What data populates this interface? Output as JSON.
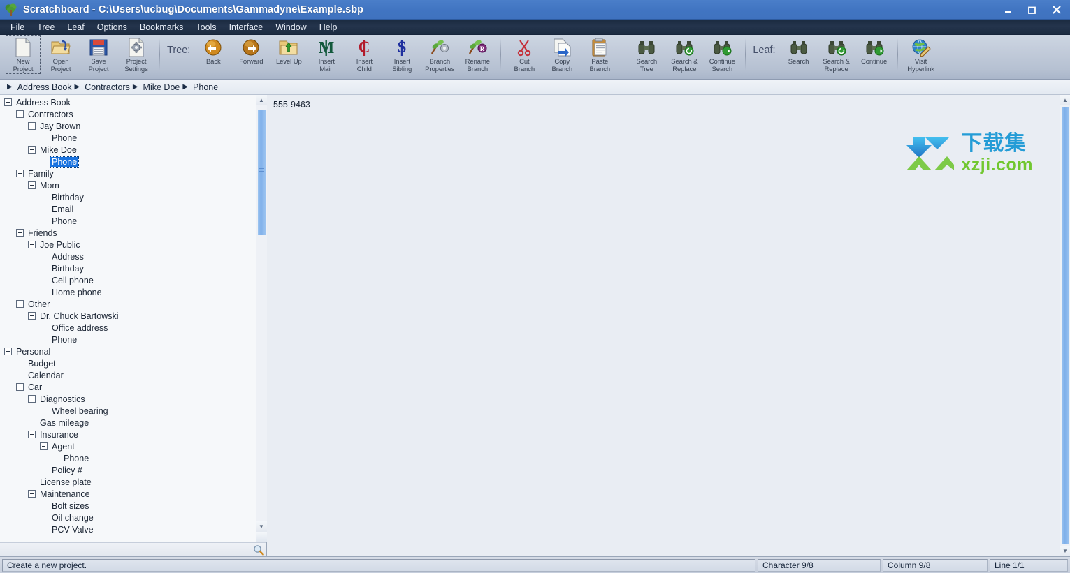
{
  "window": {
    "title": "Scratchboard - C:\\Users\\ucbug\\Documents\\Gammadyne\\Example.sbp",
    "app_icon": "tree-icon",
    "controls": {
      "minimize": "minimize-icon",
      "maximize": "maximize-icon",
      "close": "close-icon"
    }
  },
  "menubar": {
    "items": [
      {
        "label": "File",
        "accel": "F"
      },
      {
        "label": "Tree",
        "accel": "r"
      },
      {
        "label": "Leaf",
        "accel": "L"
      },
      {
        "label": "Options",
        "accel": "O"
      },
      {
        "label": "Bookmarks",
        "accel": "B"
      },
      {
        "label": "Tools",
        "accel": "T"
      },
      {
        "label": "Interface",
        "accel": "I"
      },
      {
        "label": "Window",
        "accel": "W"
      },
      {
        "label": "Help",
        "accel": "H"
      }
    ]
  },
  "toolbar": {
    "groups": [
      {
        "label": null,
        "buttons": [
          {
            "label": "New\nProject",
            "icon": "new-document-icon",
            "focused": true
          },
          {
            "label": "Open\nProject",
            "icon": "open-folder-icon",
            "focused": false
          },
          {
            "label": "Save\nProject",
            "icon": "floppy-disk-icon",
            "focused": false
          },
          {
            "label": "Project\nSettings",
            "icon": "document-gear-icon",
            "focused": false
          }
        ]
      },
      {
        "label": "Tree:",
        "buttons": [
          {
            "label": "Back",
            "icon": "back-arrow-icon",
            "focused": false
          },
          {
            "label": "Forward",
            "icon": "forward-arrow-icon",
            "focused": false
          },
          {
            "label": "Level Up",
            "icon": "folder-up-icon",
            "focused": false
          },
          {
            "label": "Insert\nMain",
            "icon": "insert-main-icon",
            "focused": false
          },
          {
            "label": "Insert\nChild",
            "icon": "insert-child-icon",
            "focused": false
          },
          {
            "label": "Insert\nSibling",
            "icon": "insert-sibling-icon",
            "focused": false
          },
          {
            "label": "Branch\nProperties",
            "icon": "branch-properties-icon",
            "focused": false
          },
          {
            "label": "Rename\nBranch",
            "icon": "rename-branch-icon",
            "focused": false
          }
        ]
      },
      {
        "label": null,
        "buttons": [
          {
            "label": "Cut\nBranch",
            "icon": "scissors-icon",
            "focused": false
          },
          {
            "label": "Copy\nBranch",
            "icon": "copy-icon",
            "focused": false
          },
          {
            "label": "Paste\nBranch",
            "icon": "clipboard-paste-icon",
            "focused": false
          }
        ]
      },
      {
        "label": null,
        "buttons": [
          {
            "label": "Search\nTree",
            "icon": "binoculars-icon",
            "focused": false
          },
          {
            "label": "Search &\nReplace",
            "icon": "binoculars-replace-icon",
            "focused": false
          },
          {
            "label": "Continue\nSearch",
            "icon": "binoculars-continue-icon",
            "focused": false
          }
        ]
      },
      {
        "label": "Leaf:",
        "buttons": [
          {
            "label": "Search",
            "icon": "binoculars-icon",
            "focused": false
          },
          {
            "label": "Search &\nReplace",
            "icon": "binoculars-replace-icon",
            "focused": false
          },
          {
            "label": "Continue",
            "icon": "binoculars-continue-icon",
            "focused": false
          }
        ]
      },
      {
        "label": null,
        "buttons": [
          {
            "label": "Visit\nHyperlink",
            "icon": "globe-pencil-icon",
            "focused": false
          }
        ]
      }
    ]
  },
  "breadcrumb": {
    "items": [
      "Address Book",
      "Contractors",
      "Mike Doe",
      "Phone"
    ]
  },
  "tree": {
    "nodes": [
      {
        "label": "Address Book",
        "depth": 0,
        "expandable": true,
        "selected": false
      },
      {
        "label": "Contractors",
        "depth": 1,
        "expandable": true,
        "selected": false
      },
      {
        "label": "Jay Brown",
        "depth": 2,
        "expandable": true,
        "selected": false
      },
      {
        "label": "Phone",
        "depth": 3,
        "expandable": false,
        "selected": false
      },
      {
        "label": "Mike Doe",
        "depth": 2,
        "expandable": true,
        "selected": false
      },
      {
        "label": "Phone",
        "depth": 3,
        "expandable": false,
        "selected": true
      },
      {
        "label": "Family",
        "depth": 1,
        "expandable": true,
        "selected": false
      },
      {
        "label": "Mom",
        "depth": 2,
        "expandable": true,
        "selected": false
      },
      {
        "label": "Birthday",
        "depth": 3,
        "expandable": false,
        "selected": false
      },
      {
        "label": "Email",
        "depth": 3,
        "expandable": false,
        "selected": false
      },
      {
        "label": "Phone",
        "depth": 3,
        "expandable": false,
        "selected": false
      },
      {
        "label": "Friends",
        "depth": 1,
        "expandable": true,
        "selected": false
      },
      {
        "label": "Joe Public",
        "depth": 2,
        "expandable": true,
        "selected": false
      },
      {
        "label": "Address",
        "depth": 3,
        "expandable": false,
        "selected": false
      },
      {
        "label": "Birthday",
        "depth": 3,
        "expandable": false,
        "selected": false
      },
      {
        "label": "Cell phone",
        "depth": 3,
        "expandable": false,
        "selected": false
      },
      {
        "label": "Home phone",
        "depth": 3,
        "expandable": false,
        "selected": false
      },
      {
        "label": "Other",
        "depth": 1,
        "expandable": true,
        "selected": false
      },
      {
        "label": "Dr. Chuck Bartowski",
        "depth": 2,
        "expandable": true,
        "selected": false
      },
      {
        "label": "Office address",
        "depth": 3,
        "expandable": false,
        "selected": false
      },
      {
        "label": "Phone",
        "depth": 3,
        "expandable": false,
        "selected": false
      },
      {
        "label": "Personal",
        "depth": 0,
        "expandable": true,
        "selected": false
      },
      {
        "label": "Budget",
        "depth": 1,
        "expandable": false,
        "selected": false
      },
      {
        "label": "Calendar",
        "depth": 1,
        "expandable": false,
        "selected": false
      },
      {
        "label": "Car",
        "depth": 1,
        "expandable": true,
        "selected": false
      },
      {
        "label": "Diagnostics",
        "depth": 2,
        "expandable": true,
        "selected": false
      },
      {
        "label": "Wheel bearing",
        "depth": 3,
        "expandable": false,
        "selected": false
      },
      {
        "label": "Gas mileage",
        "depth": 2,
        "expandable": false,
        "selected": false
      },
      {
        "label": "Insurance",
        "depth": 2,
        "expandable": true,
        "selected": false
      },
      {
        "label": "Agent",
        "depth": 3,
        "expandable": true,
        "selected": false
      },
      {
        "label": "Phone",
        "depth": 4,
        "expandable": false,
        "selected": false
      },
      {
        "label": "Policy #",
        "depth": 3,
        "expandable": false,
        "selected": false
      },
      {
        "label": "License plate",
        "depth": 2,
        "expandable": false,
        "selected": false
      },
      {
        "label": "Maintenance",
        "depth": 2,
        "expandable": true,
        "selected": false
      },
      {
        "label": "Bolt sizes",
        "depth": 3,
        "expandable": false,
        "selected": false
      },
      {
        "label": "Oil change",
        "depth": 3,
        "expandable": false,
        "selected": false
      },
      {
        "label": "PCV Valve",
        "depth": 3,
        "expandable": false,
        "selected": false
      }
    ],
    "scrollbar": {
      "up_arrow": "chevron-up-icon",
      "down_arrow": "chevron-down-icon",
      "menu": "scroll-menu-icon"
    },
    "search_icon": "magnifier-icon"
  },
  "editor": {
    "content": "555-9463"
  },
  "watermark": {
    "cn_text": "下载集",
    "url_text": "xzji.com",
    "logo": "xzji-arrow-logo"
  },
  "statusbar": {
    "hint": "Create a new project.",
    "character": "Character 9/8",
    "column": "Column 9/8",
    "line": "Line 1/1"
  },
  "colors": {
    "title_blue": "#4175c2",
    "menu_dark": "#1f2f47",
    "toolbar_bg": "#c2cbda",
    "selection_blue": "#1b74e0",
    "scroll_thumb": "#7fb0ea",
    "watermark_cn": "#1e9ad6",
    "watermark_url": "#6ec62a"
  }
}
